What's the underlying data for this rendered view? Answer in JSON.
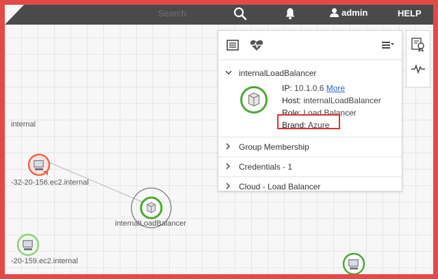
{
  "topbar": {
    "search_placeholder": "Search",
    "user_label": "admin",
    "help_label": "HELP"
  },
  "nodes": [
    {
      "label": "internal",
      "status": "none"
    },
    {
      "label": "-32-20-156.ec2.internal",
      "status": "error"
    },
    {
      "label": "internalLoadBalancer",
      "status": "ok"
    },
    {
      "label": "-20-159.ec2.internal",
      "status": "ok"
    },
    {
      "label": "",
      "status": "ok"
    }
  ],
  "panel": {
    "tabs": [
      "list-icon",
      "heartbeat-icon",
      "menu-icon"
    ],
    "title": "internalLoadBalancer",
    "details": {
      "ip_label": "IP:",
      "ip_value": "10.1.0.6",
      "more_link": "More",
      "host_label": "Host:",
      "host_value": "internalLoadBalancer",
      "role_label": "Role:",
      "role_value": "Load Balancer",
      "brand_label": "Brand:",
      "brand_value": "Azure"
    },
    "sections": [
      {
        "label": "Group Membership"
      },
      {
        "label": "Credentials - 1"
      },
      {
        "label": "Cloud - Load Balancer"
      }
    ]
  },
  "colors": {
    "topbar": "#4a4a4a",
    "frame": "#e24a47",
    "ok": "#4aa832",
    "error": "#e8664a",
    "highlight": "#d8302e"
  }
}
